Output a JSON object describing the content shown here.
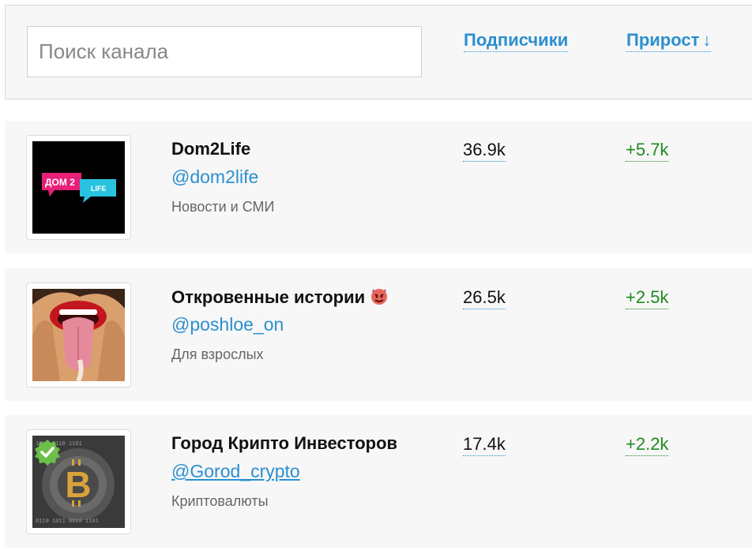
{
  "search": {
    "placeholder": "Поиск канала"
  },
  "sort": {
    "subscribers_label": "Подписчики",
    "growth_label": "Прирост",
    "growth_arrow": "↓"
  },
  "channels": [
    {
      "name": "Dom2Life",
      "handle": "@dom2life",
      "category": "Новости и СМИ",
      "subscribers": "36.9k",
      "growth": "+5.7k",
      "avatar_icon": "dom2-life-logo"
    },
    {
      "name": "Откровенные истории",
      "name_emoji": "devil-face-icon",
      "handle": "@poshloe_on",
      "category": "Для взрослых",
      "subscribers": "26.5k",
      "growth": "+2.5k",
      "avatar_icon": "open-mouth-illustration"
    },
    {
      "name": "Город Крипто Инвесторов",
      "handle": "@Gorod_crypto",
      "category": "Криптовалюты",
      "subscribers": "17.4k",
      "growth": "+2.2k",
      "avatar_icon": "bitcoin-coin-image",
      "verified": true
    }
  ],
  "colors": {
    "link": "#2a8fd0",
    "growth": "#1f8a1f",
    "row_bg": "#f7f7f7"
  }
}
